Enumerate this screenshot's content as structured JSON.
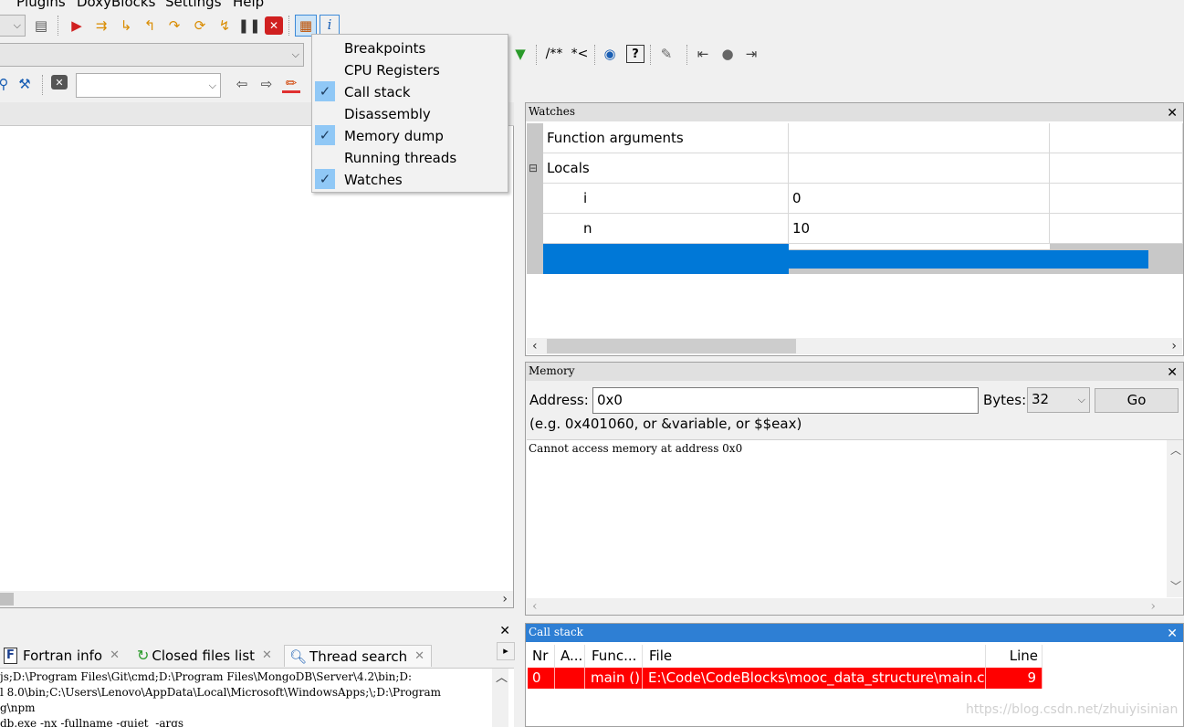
{
  "menubar": {
    "items": [
      "Plugins",
      "DoxyBlocks",
      "Settings",
      "Help"
    ]
  },
  "toolbar": {
    "doxy_comment_label": "/**",
    "doxy_line_comment_label": "*<",
    "search_combo_value": "",
    "icons": [
      "settings-combo",
      "run",
      "step-into",
      "next-line",
      "step-out",
      "run-to-cursor",
      "next-instruction",
      "pause",
      "stop",
      "debug-windows",
      "info",
      "doxy-wizard",
      "extract",
      "zoom",
      "wrench",
      "back",
      "record",
      "forward",
      "find",
      "clear",
      "prev",
      "next",
      "highlight"
    ]
  },
  "debug_windows_menu": {
    "items": [
      {
        "label": "Breakpoints",
        "checked": false
      },
      {
        "label": "CPU Registers",
        "checked": false
      },
      {
        "label": "Call stack",
        "checked": true
      },
      {
        "label": "Disassembly",
        "checked": false
      },
      {
        "label": "Memory dump",
        "checked": true
      },
      {
        "label": "Running threads",
        "checked": false
      },
      {
        "label": "Watches",
        "checked": true
      }
    ]
  },
  "watches": {
    "title": "Watches",
    "rows": [
      {
        "name": "Function arguments",
        "value": ""
      },
      {
        "name": "Locals",
        "value": ""
      },
      {
        "name": "i",
        "value": "0"
      },
      {
        "name": "n",
        "value": "10"
      }
    ],
    "expander": "⊟"
  },
  "memory": {
    "title": "Memory",
    "address_label": "Address:",
    "address_value": "0x0",
    "bytes_label": "Bytes:",
    "bytes_value": "32",
    "go_label": "Go",
    "hint": "(e.g. 0x401060, or &variable, or $$eax)",
    "output": "Cannot access memory at address 0x0"
  },
  "logs": {
    "tabs": [
      {
        "label": "Fortran info",
        "icon": "fortran-icon"
      },
      {
        "label": "Closed files list",
        "icon": "recycle-icon"
      },
      {
        "label": "Thread search",
        "icon": "search-icon"
      }
    ],
    "lines": [
      "js;D:\\Program Files\\Git\\cmd;D:\\Program Files\\MongoDB\\Server\\4.2\\bin;D:",
      "l 8.0\\bin;C:\\Users\\Lenovo\\AppData\\Local\\Microsoft\\WindowsApps;\\;D:\\Program",
      "g\\npm",
      "db.exe -nx -fullname -quiet  -args"
    ]
  },
  "callstack": {
    "title": "Call stack",
    "headers": [
      "Nr",
      "A...",
      "Func...",
      "File",
      "Line"
    ],
    "rows": [
      {
        "nr": "0",
        "addr": "",
        "func": "main ()",
        "file": "E:\\Code\\CodeBlocks\\mooc_data_structure\\main.c",
        "line": "9"
      }
    ]
  },
  "watermark": "https://blog.csdn.net/zhuiyisinian",
  "colors": {
    "selection": "#0078d7",
    "current_frame": "#ff0000",
    "menu_check": "#90c8f6"
  }
}
